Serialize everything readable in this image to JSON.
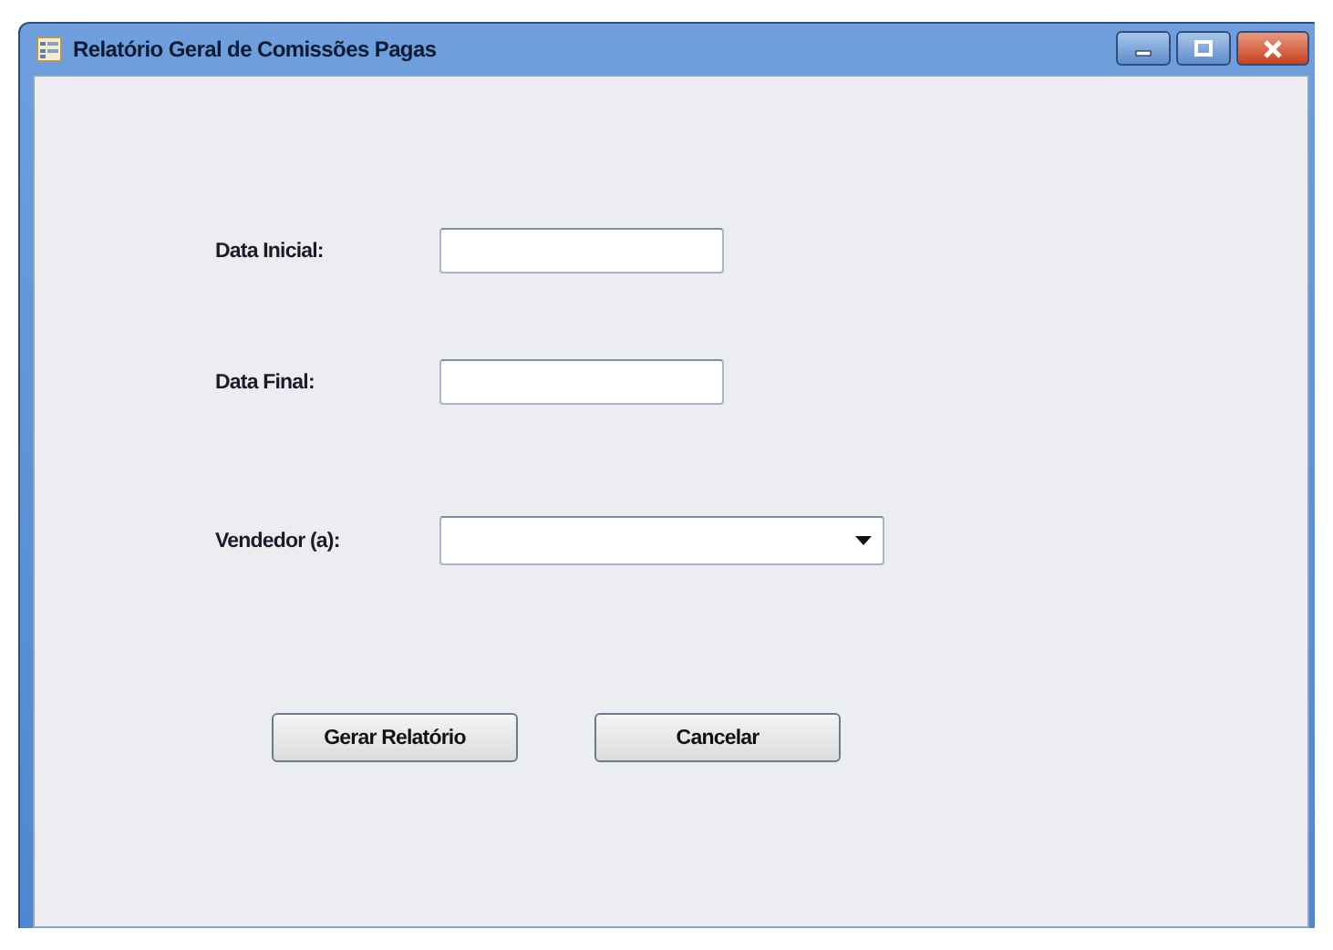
{
  "window": {
    "title": "Relatório Geral de Comissões Pagas"
  },
  "fields": [
    {
      "label": "Data Inicial:",
      "kind": "text"
    },
    {
      "label": "Data Final:",
      "kind": "text"
    },
    {
      "label": "Vendedor (a):",
      "kind": "dropdown"
    }
  ],
  "buttons": [
    "Gerar Relatório",
    "Cancelar"
  ]
}
